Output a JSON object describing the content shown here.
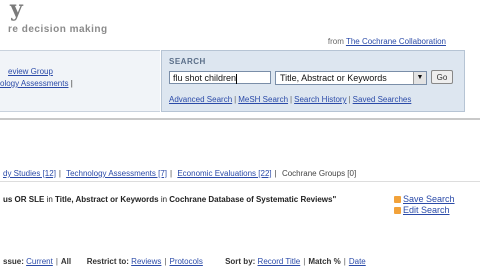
{
  "header": {
    "logo": "y",
    "tagline": "re decision making",
    "from_label": "from",
    "from_link": "The Cochrane Collaboration"
  },
  "left_panel": {
    "link1": "eview Group",
    "link2": "ology Assessments"
  },
  "search": {
    "title": "SEARCH",
    "query": "flu shot children",
    "field_selected": "Title, Abstract or Keywords",
    "go_label": "Go",
    "links": [
      "Advanced Search",
      "MeSH Search",
      "Search History",
      "Saved Searches"
    ]
  },
  "tabs": {
    "items": [
      "dy Studies [12]",
      "Technology Assessments [7]",
      "Economic Evaluations [22]",
      "Cochrane Groups [0]"
    ]
  },
  "results_line": {
    "query_part": "us OR SLE",
    "mid": " in ",
    "field": "Title, Abstract or Keywords",
    "mid2": " in ",
    "database": "Cochrane Database of Systematic Reviews",
    "end": "\""
  },
  "actions": {
    "save_search": "Save Search",
    "edit_search": "Edit Search"
  },
  "bottom_bar": {
    "issue_label": "ssue:",
    "current": "Current",
    "all": "All",
    "restrict_label": "Restrict to:",
    "reviews": "Reviews",
    "protocols": "Protocols",
    "sort_label": "Sort by:",
    "record_title": "Record Title",
    "match": "Match %",
    "date": "Date"
  }
}
